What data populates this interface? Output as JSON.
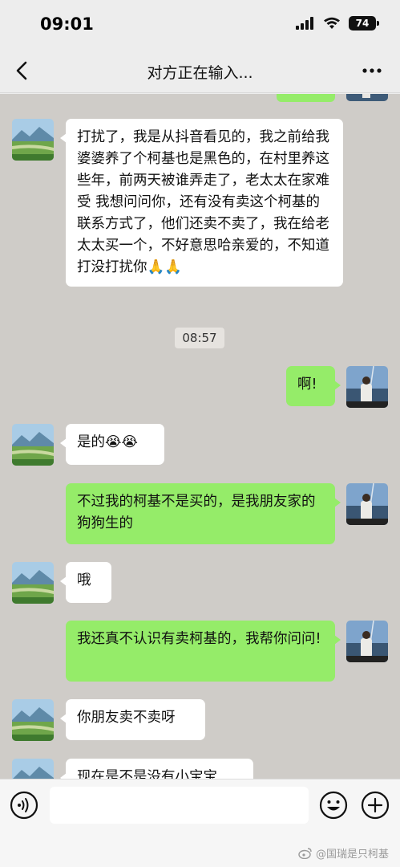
{
  "status_bar": {
    "time": "09:01",
    "battery": "74"
  },
  "nav": {
    "title": "对方正在输入..."
  },
  "messages": [
    {
      "side": "left",
      "text": "打扰了，我是从抖音看见的，我之前给我婆婆养了个柯基也是黑色的，在村里养这些年，前两天被谁弄走了，老太太在家难受 我想问问你，还有没有卖这个柯基的联系方式了，他们还卖不卖了，我在给老太太买一个，不好意思哈亲爱的，不知道打没打扰你",
      "emoji": "🙏🙏"
    },
    {
      "side": "right",
      "text": "啊!"
    },
    {
      "side": "left",
      "text": "是的",
      "emoji": "😭😭"
    },
    {
      "side": "right",
      "text": "不过我的柯基不是买的，是我朋友家的狗狗生的"
    },
    {
      "side": "left",
      "text": "哦"
    },
    {
      "side": "right",
      "text": "我还真不认识有卖柯基的，我帮你问问!"
    },
    {
      "side": "left",
      "text": "你朋友卖不卖呀"
    },
    {
      "side": "left",
      "text": "现在是不是没有小宝宝"
    }
  ],
  "timestamp": "08:57",
  "input": {
    "placeholder": ""
  },
  "watermark": "@国瑞是只柯基",
  "colors": {
    "chat_bg": "#cfccc8",
    "right_bubble": "#95ec69",
    "left_bubble": "#ffffff",
    "header_bg": "#ededed"
  },
  "icons": [
    "back-icon",
    "more-icon",
    "voice-icon",
    "emoji-icon",
    "plus-icon",
    "signal-icon",
    "wifi-icon"
  ]
}
